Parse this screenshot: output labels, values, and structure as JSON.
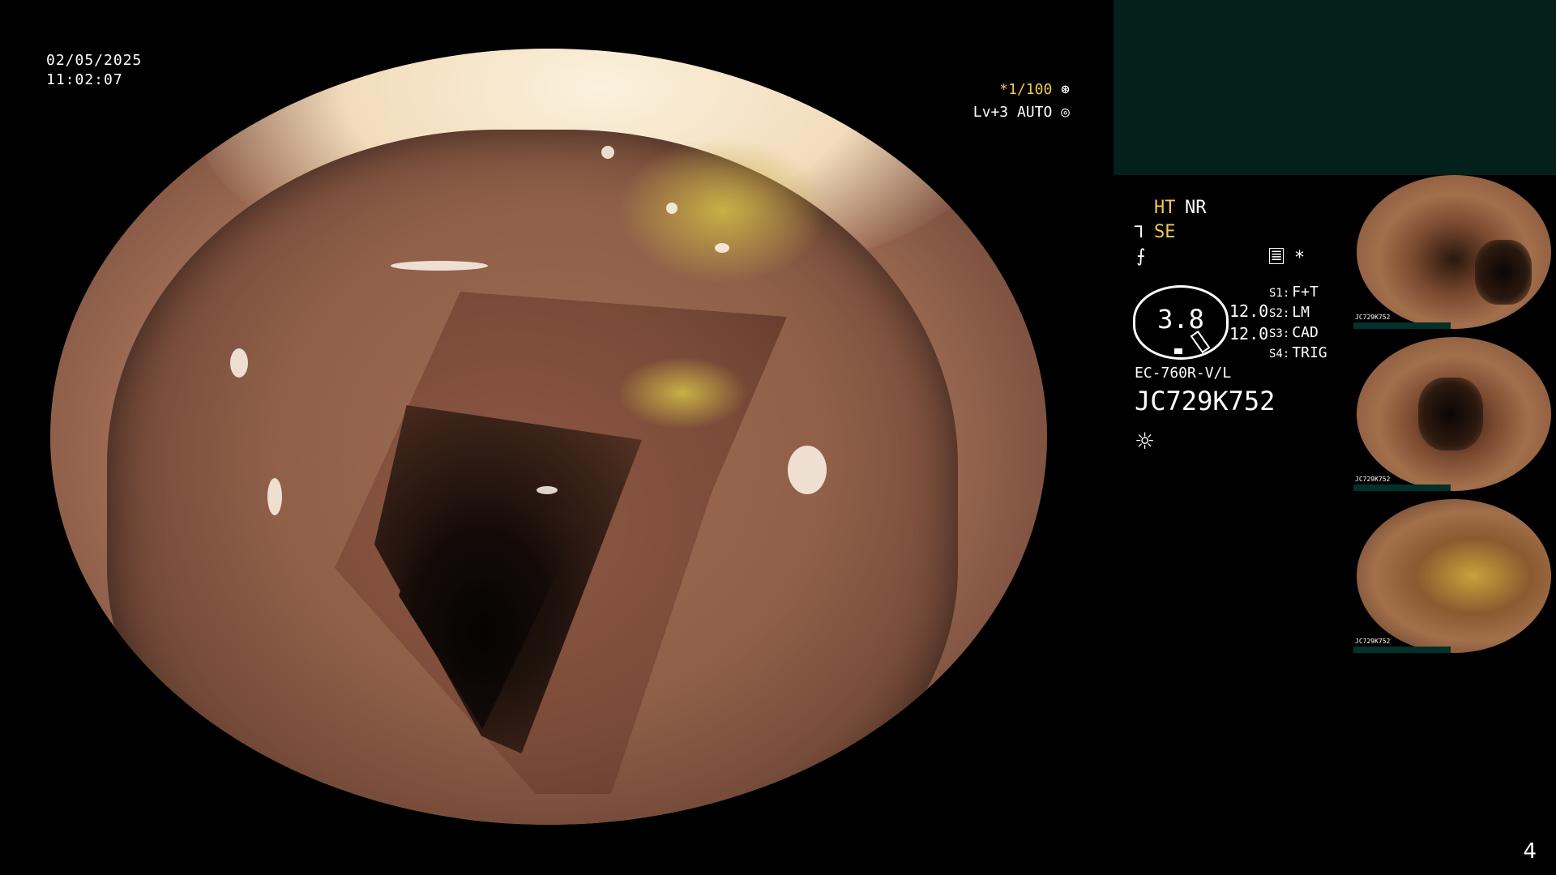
{
  "overlay": {
    "date": "02/05/2025",
    "time": "11:02:07",
    "shutter": "*1/100",
    "level": "Lv+3 AUTO"
  },
  "settings": {
    "ht": "HT",
    "nr": "NR",
    "se": "SE",
    "gauge_value": "3.8",
    "values": [
      "12.0",
      "12.0"
    ],
    "switches": [
      {
        "key": "S1:",
        "value": "F+T"
      },
      {
        "key": "S2:",
        "value": "LM"
      },
      {
        "key": "S3:",
        "value": "CAD"
      },
      {
        "key": "S4:",
        "value": "TRIG"
      }
    ],
    "scope_model": "EC-760R-V/L",
    "serial": "JC729K752"
  },
  "thumbnails": [
    {
      "label": "JC729K752"
    },
    {
      "label": "JC729K752"
    },
    {
      "label": "JC729K752"
    }
  ],
  "page_number": "4",
  "icons": {
    "shutter": "aperture-icon",
    "auto": "iris-icon",
    "mode": "scope-mode-icon",
    "freeze": "freeze-icon",
    "record": "record-icon",
    "asterisk": "asterisk-icon",
    "light": "light-icon"
  },
  "colors": {
    "highlight": "#f2c94c",
    "panel": "#03201b"
  }
}
